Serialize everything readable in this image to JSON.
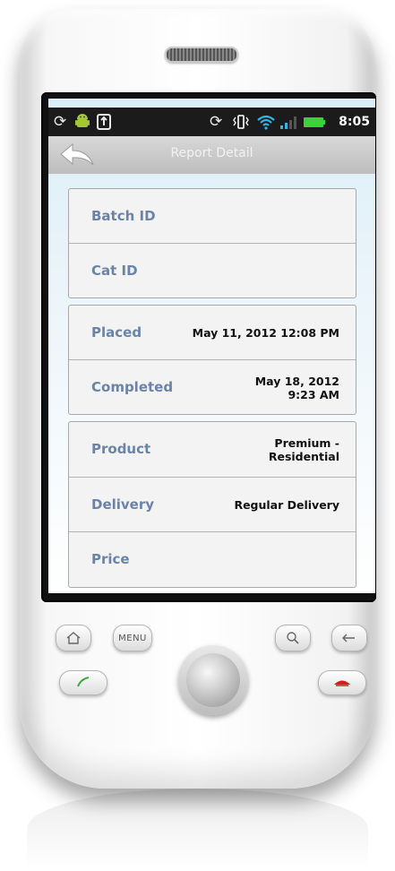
{
  "status_bar": {
    "time": "8:05",
    "icons": [
      "sync-icon",
      "android-icon",
      "usb-icon",
      "sync-icon",
      "vibrate-icon",
      "wifi-icon",
      "signal-icon",
      "battery-icon"
    ],
    "battery_color": "#3ecf3e"
  },
  "header": {
    "title": "Report Detail",
    "back_icon": "back-arrow-icon"
  },
  "groups": [
    {
      "rows": [
        {
          "label": "Batch ID",
          "value": ""
        },
        {
          "label": "Cat ID",
          "value": ""
        }
      ]
    },
    {
      "rows": [
        {
          "label": "Placed",
          "value": "May 11, 2012 12:08 PM"
        },
        {
          "label": "Completed",
          "value": "May 18, 2012\n9:23 AM"
        }
      ]
    },
    {
      "rows": [
        {
          "label": "Product",
          "value": "Premium -\nResidential"
        },
        {
          "label": "Delivery",
          "value": "Regular Delivery"
        },
        {
          "label": "Price",
          "value": ""
        }
      ]
    }
  ],
  "hardware_buttons": {
    "home_icon": "home-icon",
    "menu_label": "MENU",
    "search_icon": "search-icon",
    "back_icon": "back-icon",
    "call_icon": "call-icon",
    "end_call_icon": "end-call-icon",
    "call_color": "#3aa83a",
    "end_call_color": "#d02020"
  },
  "colors": {
    "label": "#6a83a8",
    "value": "#111111",
    "title": "#f2f2f2"
  }
}
